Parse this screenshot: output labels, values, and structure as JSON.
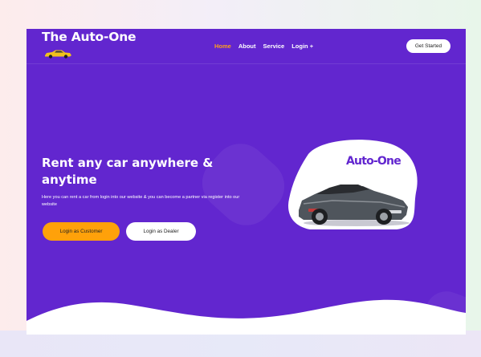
{
  "brand": {
    "name": "The Auto-One",
    "logo_icon": "yellow-car-icon"
  },
  "nav": {
    "links": [
      {
        "label": "Home",
        "active": true
      },
      {
        "label": "About",
        "active": false
      },
      {
        "label": "Service",
        "active": false
      },
      {
        "label": "Login +",
        "active": false
      }
    ],
    "cta_label": "Get Started"
  },
  "hero": {
    "title": "Rent any car anywhere & anytime",
    "subtitle": "Here you can rent a car from login into our website & you can become a partner via register into our website",
    "primary_button": "Login as Customer",
    "secondary_button": "Login as Dealer",
    "image_label": "Auto-One"
  },
  "colors": {
    "primary": "#6226cf",
    "accent": "#ffa10a",
    "nav_active": "#ff9f1c",
    "text_light": "#ffffff"
  }
}
